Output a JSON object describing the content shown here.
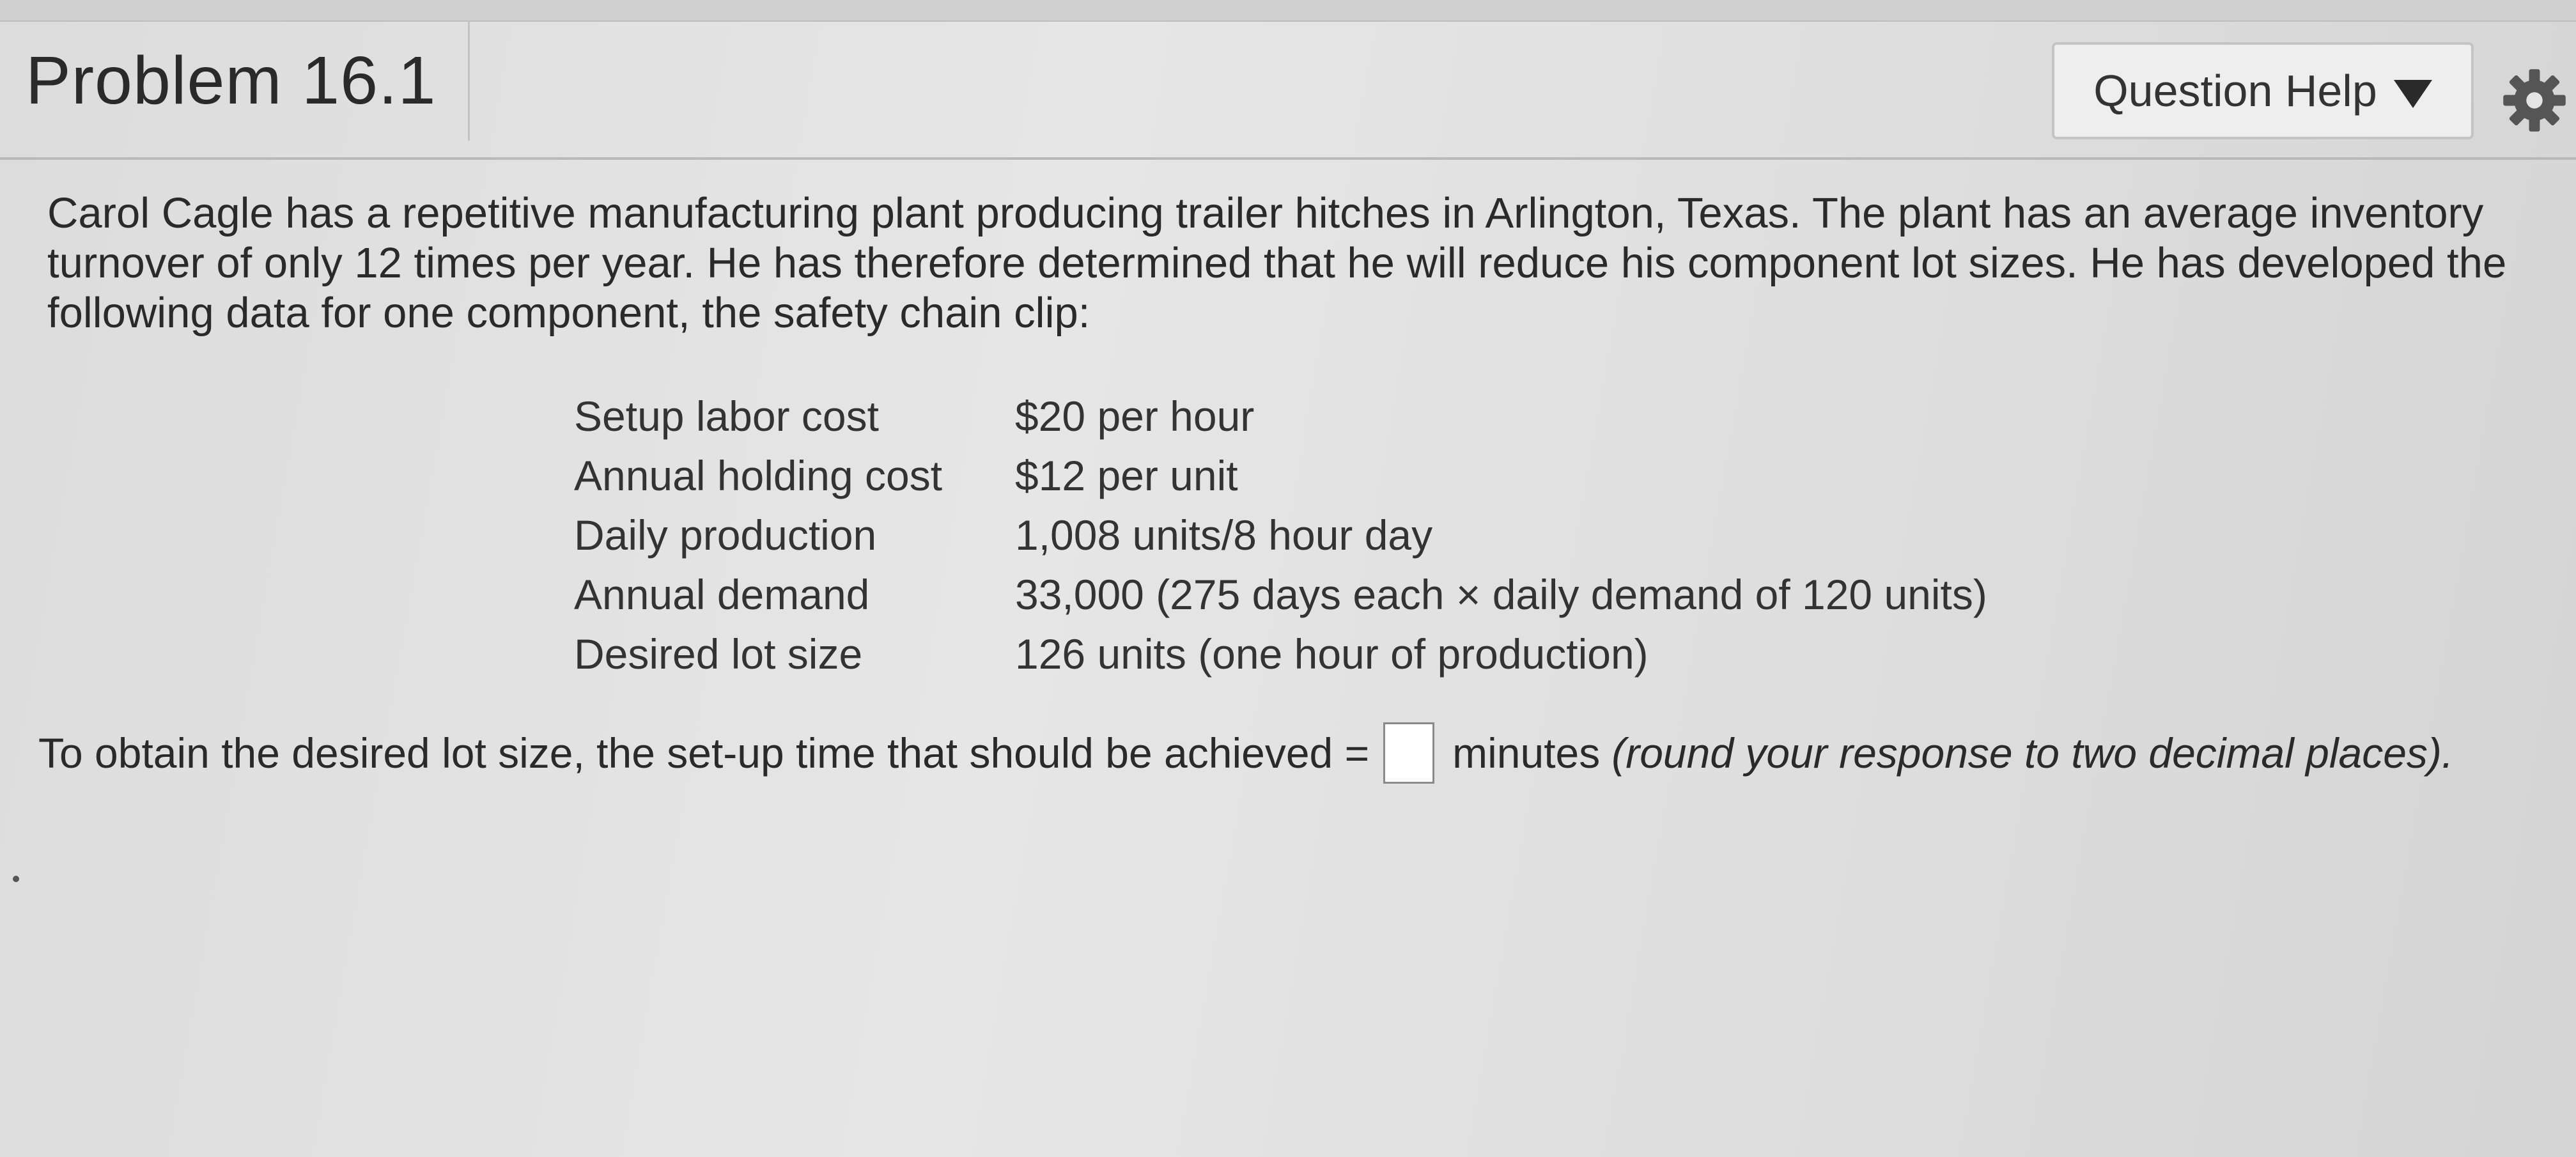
{
  "header": {
    "title": "Problem 16.1",
    "question_help_label": "Question Help"
  },
  "icons": {
    "caret": "caret-down-icon",
    "settings": "gear-icon"
  },
  "problem": {
    "text": "Carol Cagle has a repetitive manufacturing plant producing trailer hitches in Arlington, Texas. The plant has an average inventory turnover of only 12 times per year. He has therefore determined that he will reduce his component lot sizes. He has developed the following data for one component, the safety chain clip:",
    "data_rows": [
      {
        "label": "Setup labor cost",
        "value": "$20 per hour"
      },
      {
        "label": "Annual holding cost",
        "value": "$12 per unit"
      },
      {
        "label": "Daily production",
        "value": "1,008 units/8 hour day"
      },
      {
        "label": "Annual demand",
        "value": "33,000 (275 days each × daily demand of 120 units)"
      },
      {
        "label": "Desired lot size",
        "value": "126 units (one hour of production)"
      }
    ]
  },
  "answer": {
    "prompt": "To obtain the desired lot size, the set-up time that should be achieved =",
    "input_value": "",
    "unit": "minutes",
    "hint": "(round your response to two decimal places)."
  }
}
